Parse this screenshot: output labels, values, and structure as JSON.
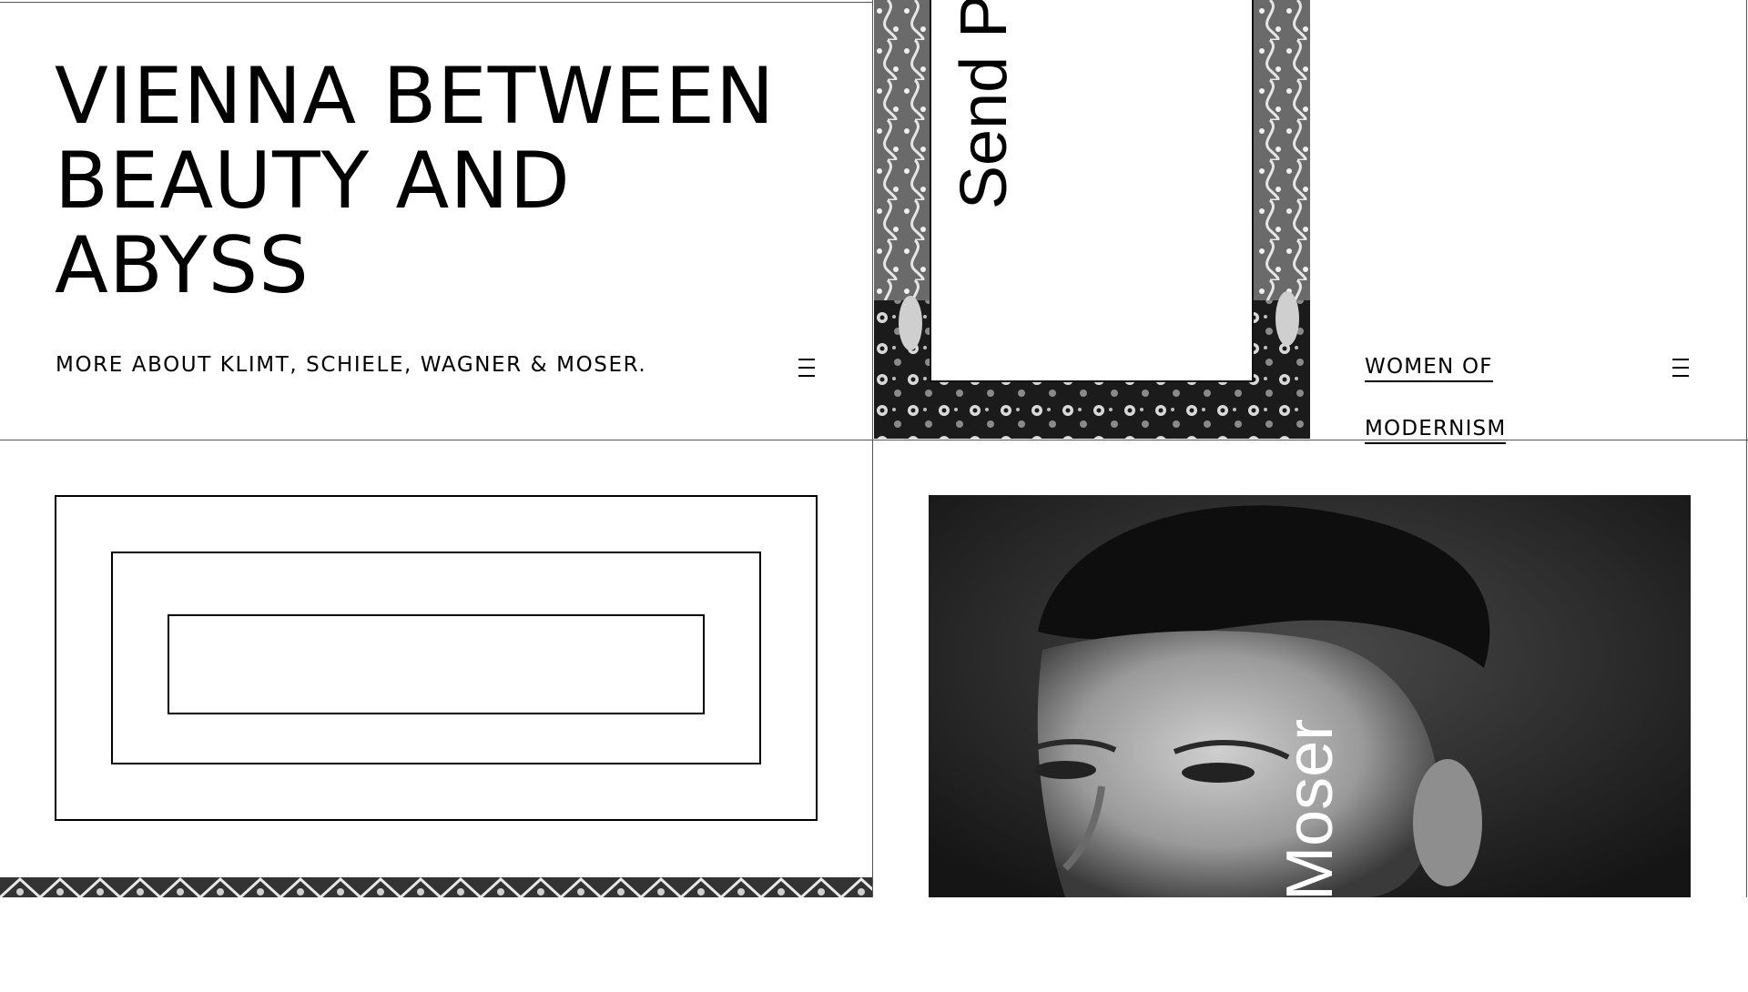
{
  "hero": {
    "title": "VIENNA BETWEEN\nBEAUTY AND\nABYSS",
    "subtitle": "MORE ABOUT KLIMT, SCHIELE, WAGNER & MOSER."
  },
  "poster_tile": {
    "text": "Send Po"
  },
  "women_tile": {
    "link_line1": "WOMEN OF",
    "link_line2": "MODERNISM"
  },
  "moser_tile": {
    "text": "an Moser"
  },
  "icons": {
    "menu": "hamburger-menu-icon"
  },
  "colors": {
    "background": "#ffffff",
    "text": "#000000",
    "grid_line": "#555555"
  }
}
